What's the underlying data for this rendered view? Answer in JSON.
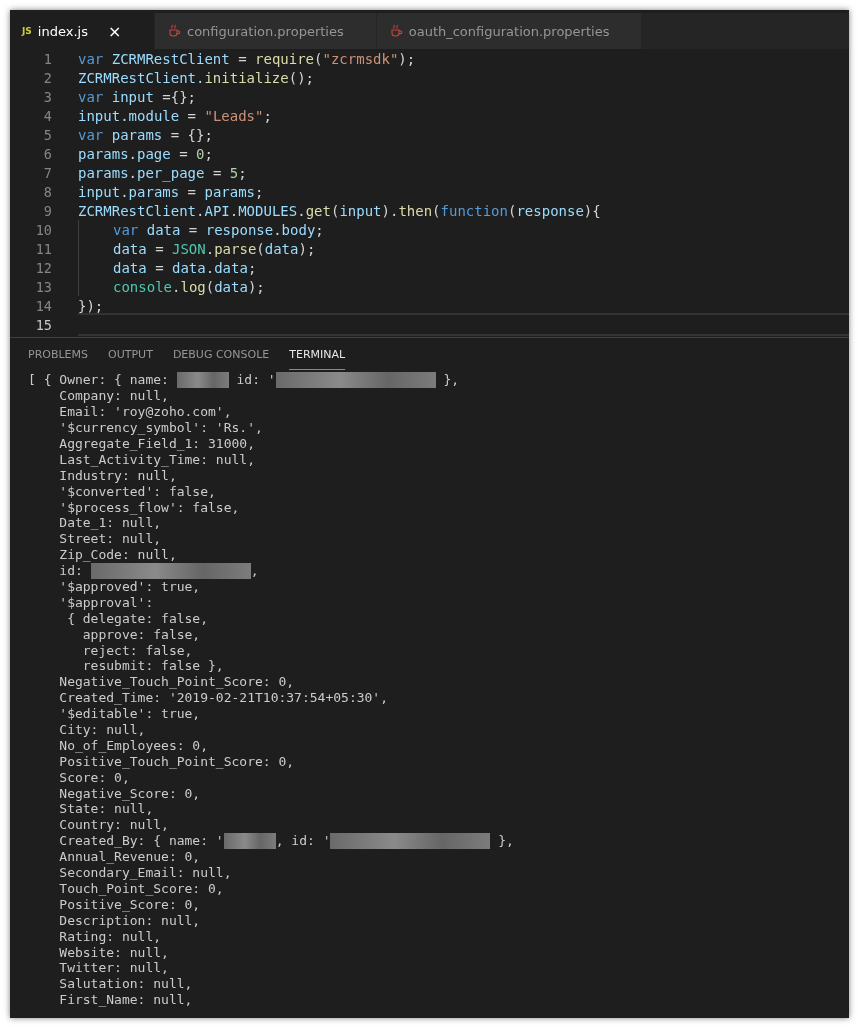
{
  "tabs": [
    {
      "label": "index.js",
      "kind": "js",
      "icon_text": "JS",
      "selected": true,
      "close": "×"
    },
    {
      "label": "configuration.properties",
      "kind": "cup",
      "selected": false
    },
    {
      "label": "oauth_configuration.properties",
      "kind": "cup",
      "selected": false
    }
  ],
  "editor": {
    "lines": [
      {
        "number": "1",
        "indent": false,
        "tokens": [
          {
            "kind": "kw",
            "text": "var "
          },
          {
            "kind": "var",
            "text": "ZCRMRestClient"
          },
          {
            "kind": "p",
            "text": " = "
          },
          {
            "kind": "fn",
            "text": "require"
          },
          {
            "kind": "p",
            "text": "("
          },
          {
            "kind": "str",
            "text": "\"zcrmsdk\""
          },
          {
            "kind": "p",
            "text": ");"
          }
        ]
      },
      {
        "number": "2",
        "indent": false,
        "tokens": [
          {
            "kind": "var",
            "text": "ZCRMRestClient."
          },
          {
            "kind": "fn",
            "text": "initialize"
          },
          {
            "kind": "p",
            "text": "();"
          }
        ]
      },
      {
        "number": "3",
        "indent": false,
        "tokens": [
          {
            "kind": "kw",
            "text": "var "
          },
          {
            "kind": "var",
            "text": "input"
          },
          {
            "kind": "p",
            "text": " ={};"
          }
        ]
      },
      {
        "number": "4",
        "indent": false,
        "tokens": [
          {
            "kind": "var",
            "text": "input"
          },
          {
            "kind": "p",
            "text": "."
          },
          {
            "kind": "var",
            "text": "module"
          },
          {
            "kind": "p",
            "text": " = "
          },
          {
            "kind": "str",
            "text": "\"Leads\""
          },
          {
            "kind": "p",
            "text": ";"
          }
        ]
      },
      {
        "number": "5",
        "indent": false,
        "tokens": [
          {
            "kind": "kw",
            "text": "var "
          },
          {
            "kind": "var",
            "text": "params"
          },
          {
            "kind": "p",
            "text": " = {};"
          }
        ]
      },
      {
        "number": "6",
        "indent": false,
        "tokens": [
          {
            "kind": "var",
            "text": "params"
          },
          {
            "kind": "p",
            "text": "."
          },
          {
            "kind": "var",
            "text": "page"
          },
          {
            "kind": "p",
            "text": " = "
          },
          {
            "kind": "num",
            "text": "0"
          },
          {
            "kind": "p",
            "text": ";"
          }
        ]
      },
      {
        "number": "7",
        "indent": false,
        "tokens": [
          {
            "kind": "var",
            "text": "params"
          },
          {
            "kind": "p",
            "text": "."
          },
          {
            "kind": "var",
            "text": "per_page"
          },
          {
            "kind": "p",
            "text": " = "
          },
          {
            "kind": "num",
            "text": "5"
          },
          {
            "kind": "p",
            "text": ";"
          }
        ]
      },
      {
        "number": "8",
        "indent": false,
        "tokens": [
          {
            "kind": "var",
            "text": "input"
          },
          {
            "kind": "p",
            "text": "."
          },
          {
            "kind": "var",
            "text": "params"
          },
          {
            "kind": "p",
            "text": " = "
          },
          {
            "kind": "var",
            "text": "params"
          },
          {
            "kind": "p",
            "text": ";"
          }
        ]
      },
      {
        "number": "9",
        "indent": false,
        "tokens": [
          {
            "kind": "var",
            "text": "ZCRMRestClient"
          },
          {
            "kind": "p",
            "text": "."
          },
          {
            "kind": "var",
            "text": "API"
          },
          {
            "kind": "p",
            "text": "."
          },
          {
            "kind": "var",
            "text": "MODULES"
          },
          {
            "kind": "p",
            "text": "."
          },
          {
            "kind": "fn",
            "text": "get"
          },
          {
            "kind": "p",
            "text": "("
          },
          {
            "kind": "var",
            "text": "input"
          },
          {
            "kind": "p",
            "text": ")."
          },
          {
            "kind": "fn",
            "text": "then"
          },
          {
            "kind": "p",
            "text": "("
          },
          {
            "kind": "kw",
            "text": "function"
          },
          {
            "kind": "p",
            "text": "("
          },
          {
            "kind": "var",
            "text": "response"
          },
          {
            "kind": "p",
            "text": "){"
          }
        ]
      },
      {
        "number": "10",
        "indent": true,
        "tokens": [
          {
            "kind": "kw",
            "text": "var "
          },
          {
            "kind": "var",
            "text": "data"
          },
          {
            "kind": "p",
            "text": " = "
          },
          {
            "kind": "var",
            "text": "response"
          },
          {
            "kind": "p",
            "text": "."
          },
          {
            "kind": "var",
            "text": "body"
          },
          {
            "kind": "p",
            "text": ";"
          }
        ]
      },
      {
        "number": "11",
        "indent": true,
        "tokens": [
          {
            "kind": "var",
            "text": "data"
          },
          {
            "kind": "p",
            "text": " = "
          },
          {
            "kind": "type",
            "text": "JSON"
          },
          {
            "kind": "p",
            "text": "."
          },
          {
            "kind": "fn",
            "text": "parse"
          },
          {
            "kind": "p",
            "text": "("
          },
          {
            "kind": "var",
            "text": "data"
          },
          {
            "kind": "p",
            "text": ");"
          }
        ]
      },
      {
        "number": "12",
        "indent": true,
        "tokens": [
          {
            "kind": "var",
            "text": "data"
          },
          {
            "kind": "p",
            "text": " = "
          },
          {
            "kind": "var",
            "text": "data"
          },
          {
            "kind": "p",
            "text": "."
          },
          {
            "kind": "var",
            "text": "data"
          },
          {
            "kind": "p",
            "text": ";"
          }
        ]
      },
      {
        "number": "13",
        "indent": true,
        "tokens": [
          {
            "kind": "type",
            "text": "console"
          },
          {
            "kind": "p",
            "text": "."
          },
          {
            "kind": "fn",
            "text": "log"
          },
          {
            "kind": "p",
            "text": "("
          },
          {
            "kind": "var",
            "text": "data"
          },
          {
            "kind": "p",
            "text": ");"
          }
        ]
      },
      {
        "number": "14",
        "indent": false,
        "tokens": [
          {
            "kind": "p",
            "text": "});"
          }
        ]
      },
      {
        "number": "15",
        "indent": false,
        "current": true
      }
    ]
  },
  "panel_tabs": [
    {
      "label": "PROBLEMS",
      "selected": false
    },
    {
      "label": "OUTPUT",
      "selected": false
    },
    {
      "label": "DEBUG CONSOLE",
      "selected": false
    },
    {
      "label": "TERMINAL",
      "selected": true
    }
  ],
  "terminal": [
    {
      "segments": [
        {
          "kind": "text",
          "text": "[ { Owner: { name: "
        },
        {
          "kind": "redacted-short"
        },
        {
          "kind": "text",
          "text": " id: '"
        },
        {
          "kind": "redacted-long"
        },
        {
          "kind": "text",
          "text": " },"
        }
      ]
    },
    {
      "segments": [
        {
          "kind": "text",
          "text": "    Company: null,"
        }
      ]
    },
    {
      "segments": [
        {
          "kind": "text",
          "text": "    Email: 'roy@zoho.com',"
        }
      ]
    },
    {
      "segments": [
        {
          "kind": "text",
          "text": "    '$currency_symbol': 'Rs.',"
        }
      ]
    },
    {
      "segments": [
        {
          "kind": "text",
          "text": "    Aggregate_Field_1: 31000,"
        }
      ]
    },
    {
      "segments": [
        {
          "kind": "text",
          "text": "    Last_Activity_Time: null,"
        }
      ]
    },
    {
      "segments": [
        {
          "kind": "text",
          "text": "    Industry: null,"
        }
      ]
    },
    {
      "segments": [
        {
          "kind": "text",
          "text": "    '$converted': false,"
        }
      ]
    },
    {
      "segments": [
        {
          "kind": "text",
          "text": "    '$process_flow': false,"
        }
      ]
    },
    {
      "segments": [
        {
          "kind": "text",
          "text": "    Date_1: null,"
        }
      ]
    },
    {
      "segments": [
        {
          "kind": "text",
          "text": "    Street: null,"
        }
      ]
    },
    {
      "segments": [
        {
          "kind": "text",
          "text": "    Zip_Code: null,"
        }
      ]
    },
    {
      "segments": [
        {
          "kind": "text",
          "text": "    id: "
        },
        {
          "kind": "redacted-long"
        },
        {
          "kind": "text",
          "text": ","
        }
      ]
    },
    {
      "segments": [
        {
          "kind": "text",
          "text": "    '$approved': true,"
        }
      ]
    },
    {
      "segments": [
        {
          "kind": "text",
          "text": "    '$approval':"
        }
      ]
    },
    {
      "segments": [
        {
          "kind": "text",
          "text": "     { delegate: false,"
        }
      ]
    },
    {
      "segments": [
        {
          "kind": "text",
          "text": "       approve: false,"
        }
      ]
    },
    {
      "segments": [
        {
          "kind": "text",
          "text": "       reject: false,"
        }
      ]
    },
    {
      "segments": [
        {
          "kind": "text",
          "text": "       resubmit: false },"
        }
      ]
    },
    {
      "segments": [
        {
          "kind": "text",
          "text": "    Negative_Touch_Point_Score: 0,"
        }
      ]
    },
    {
      "segments": [
        {
          "kind": "text",
          "text": "    Created_Time: '2019-02-21T10:37:54+05:30',"
        }
      ]
    },
    {
      "segments": [
        {
          "kind": "text",
          "text": "    '$editable': true,"
        }
      ]
    },
    {
      "segments": [
        {
          "kind": "text",
          "text": "    City: null,"
        }
      ]
    },
    {
      "segments": [
        {
          "kind": "text",
          "text": "    No_of_Employees: 0,"
        }
      ]
    },
    {
      "segments": [
        {
          "kind": "text",
          "text": "    Positive_Touch_Point_Score: 0,"
        }
      ]
    },
    {
      "segments": [
        {
          "kind": "text",
          "text": "    Score: 0,"
        }
      ]
    },
    {
      "segments": [
        {
          "kind": "text",
          "text": "    Negative_Score: 0,"
        }
      ]
    },
    {
      "segments": [
        {
          "kind": "text",
          "text": "    State: null,"
        }
      ]
    },
    {
      "segments": [
        {
          "kind": "text",
          "text": "    Country: null,"
        }
      ]
    },
    {
      "segments": [
        {
          "kind": "text",
          "text": "    Created_By: { name: '"
        },
        {
          "kind": "redacted-short"
        },
        {
          "kind": "text",
          "text": ", id: '"
        },
        {
          "kind": "redacted-long"
        },
        {
          "kind": "text",
          "text": " },"
        }
      ]
    },
    {
      "segments": [
        {
          "kind": "text",
          "text": "    Annual_Revenue: 0,"
        }
      ]
    },
    {
      "segments": [
        {
          "kind": "text",
          "text": "    Secondary_Email: null,"
        }
      ]
    },
    {
      "segments": [
        {
          "kind": "text",
          "text": "    Touch_Point_Score: 0,"
        }
      ]
    },
    {
      "segments": [
        {
          "kind": "text",
          "text": "    Positive_Score: 0,"
        }
      ]
    },
    {
      "segments": [
        {
          "kind": "text",
          "text": "    Description: null,"
        }
      ]
    },
    {
      "segments": [
        {
          "kind": "text",
          "text": "    Rating: null,"
        }
      ]
    },
    {
      "segments": [
        {
          "kind": "text",
          "text": "    Website: null,"
        }
      ]
    },
    {
      "segments": [
        {
          "kind": "text",
          "text": "    Twitter: null,"
        }
      ]
    },
    {
      "segments": [
        {
          "kind": "text",
          "text": "    Salutation: null,"
        }
      ]
    },
    {
      "segments": [
        {
          "kind": "text",
          "text": "    First_Name: null,"
        }
      ]
    }
  ]
}
